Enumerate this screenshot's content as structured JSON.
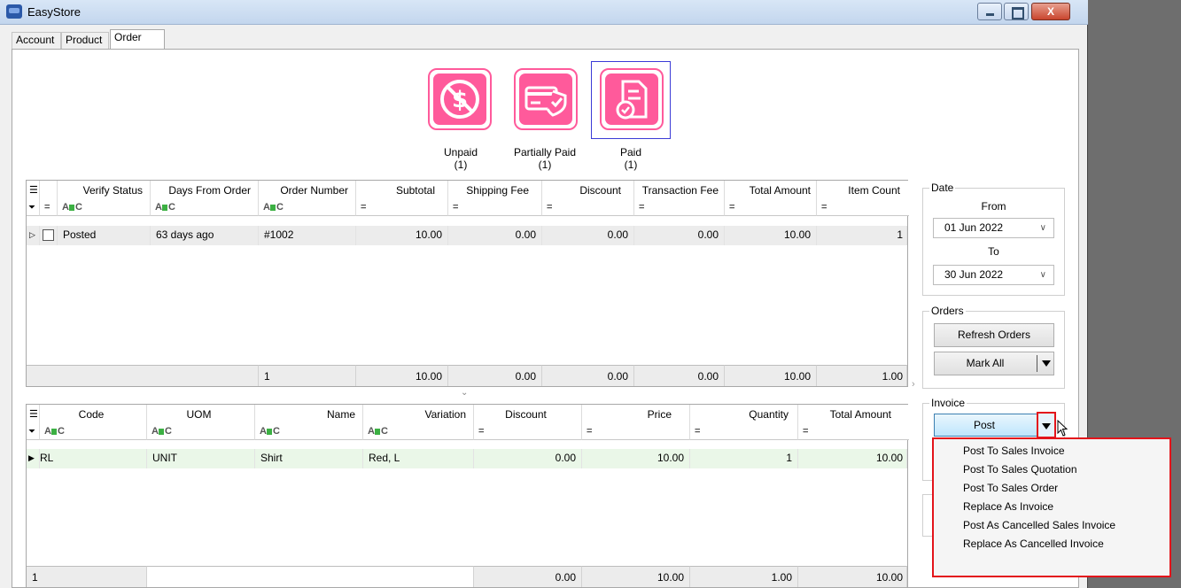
{
  "window": {
    "title": "EasyStore",
    "close_label": "X"
  },
  "tabs": [
    {
      "label": "Account"
    },
    {
      "label": "Product"
    },
    {
      "label": "Order"
    }
  ],
  "status_filters": [
    {
      "label": "Unpaid",
      "count": "(1)",
      "icon": "unpaid-icon"
    },
    {
      "label": "Partially Paid",
      "count": "(1)",
      "icon": "card-shield-icon"
    },
    {
      "label": "Paid",
      "count": "(1)",
      "icon": "paid-document-icon",
      "selected": true
    }
  ],
  "orders_grid": {
    "columns": [
      "Verify Status",
      "Days From Order",
      "Order Number",
      "Subtotal",
      "Shipping Fee",
      "Discount",
      "Transaction Fee",
      "Total Amount",
      "Item Count"
    ],
    "rows": [
      {
        "verify_status": "Posted",
        "days_from_order": "63 days ago",
        "order_number": "#1002",
        "subtotal": "10.00",
        "shipping_fee": "0.00",
        "discount": "0.00",
        "transaction_fee": "0.00",
        "total_amount": "10.00",
        "item_count": "1"
      }
    ],
    "footer": {
      "count": "1",
      "subtotal": "10.00",
      "shipping_fee": "0.00",
      "discount": "0.00",
      "transaction_fee": "0.00",
      "total_amount": "10.00",
      "item_count": "1.00"
    }
  },
  "items_grid": {
    "columns": [
      "Code",
      "UOM",
      "Name",
      "Variation",
      "Discount",
      "Price",
      "Quantity",
      "Total Amount"
    ],
    "rows": [
      {
        "code": "RL",
        "uom": "UNIT",
        "name": "Shirt",
        "variation": "Red, L",
        "discount": "0.00",
        "price": "10.00",
        "quantity": "1",
        "total_amount": "10.00"
      }
    ],
    "footer": {
      "count": "1",
      "discount": "0.00",
      "price": "10.00",
      "quantity": "1.00",
      "total_amount": "10.00"
    }
  },
  "date_panel": {
    "title": "Date",
    "from_label": "From",
    "from_value": "01 Jun 2022",
    "to_label": "To",
    "to_value": "30 Jun 2022"
  },
  "orders_panel": {
    "title": "Orders",
    "refresh_label": "Refresh Orders",
    "mark_all_label": "Mark All"
  },
  "invoice_panel": {
    "title": "Invoice",
    "post_label": "Post",
    "menu_items": [
      "Post To Sales Invoice",
      "Post To Sales Quotation",
      "Post To Sales Order",
      "Replace As Invoice",
      "Post As Cancelled Sales Invoice",
      "Replace As Cancelled Invoice"
    ]
  },
  "colors": {
    "accent_pink": "#ff5a9b",
    "selected_frame": "#3b3bd6",
    "highlight_red": "#e3141b",
    "item_row_bg": "#eaf7e8"
  }
}
